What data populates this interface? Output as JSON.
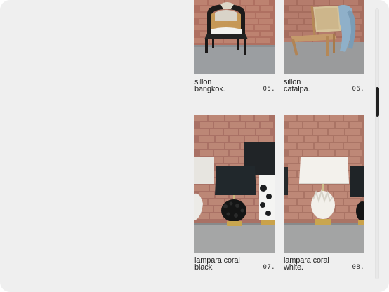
{
  "products": [
    {
      "name": "sillon\nbangkok.",
      "number": "05.",
      "icon": "rattan-armchair-photo"
    },
    {
      "name": "sillon\ncatalpa.",
      "number": "06.",
      "icon": "wooden-lounge-chair-photo"
    },
    {
      "name": "lampara coral\nblack.",
      "number": "07.",
      "icon": "black-coral-lamp-photo"
    },
    {
      "name": "lampara coral\nwhite.",
      "number": "08.",
      "icon": "white-coral-lamp-photo"
    }
  ],
  "colors": {
    "background": "#efefef",
    "text": "#1f1f1f",
    "brick": "#a65d4f",
    "scrollbar_thumb": "#202020"
  }
}
